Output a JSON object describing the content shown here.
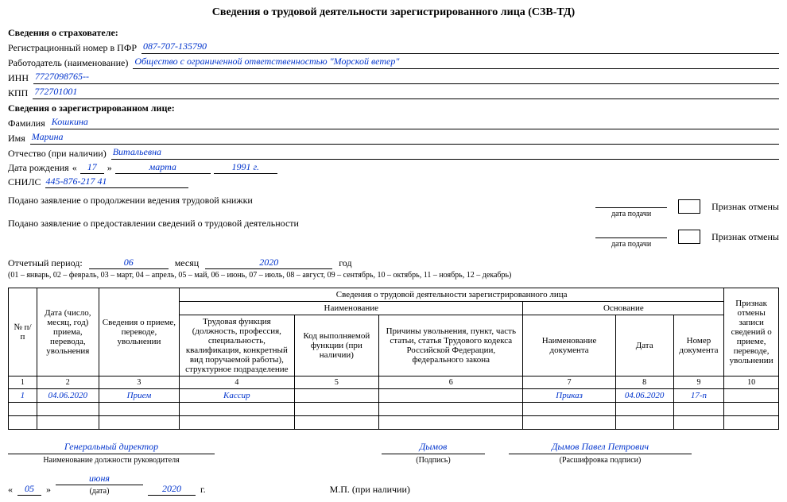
{
  "title": "Сведения о трудовой деятельности зарегистрированного лица (СЗВ-ТД)",
  "insurer": {
    "header": "Сведения о страхователе:",
    "reg_label": "Регистрационный номер в ПФР",
    "reg_value": "087-707-135790",
    "employer_label": "Работодатель (наименование)",
    "employer_value": "Общество с ограниченной ответственностью \"Морской ветер\"",
    "inn_label": "ИНН",
    "inn_value": "7727098765--",
    "kpp_label": "КПП",
    "kpp_value": "772701001"
  },
  "person": {
    "header": "Сведения о зарегистрированном лице:",
    "lastname_label": "Фамилия",
    "lastname_value": "Кошкина",
    "firstname_label": "Имя",
    "firstname_value": "Марина",
    "patronymic_label": "Отчество (при наличии)",
    "patronymic_value": "Витальевна",
    "dob_label": "Дата рождения",
    "dob_day": "17",
    "dob_month": "марта",
    "dob_year": "1991 г.",
    "snils_label": "СНИЛС",
    "snils_value": "445-876-217 41"
  },
  "apps": {
    "line1": "Подано заявление о продолжении ведения трудовой книжки",
    "line2": "Подано заявление о предоставлении сведений о трудовой деятельности",
    "date_submit": "дата подачи",
    "cancel_mark": "Признак отмены"
  },
  "period": {
    "label": "Отчетный период:",
    "month_value": "06",
    "month_label": "месяц",
    "year_value": "2020",
    "year_label": "год",
    "note": "(01 – январь, 02 – февраль, 03 – март, 04 – апрель, 05 – май, 06 – июнь, 07 – июль, 08 – август, 09 – сентябрь, 10 – октябрь, 11 – ноябрь, 12 – декабрь)"
  },
  "table": {
    "main_header": "Сведения о трудовой деятельности зарегистрированного лица",
    "col_np": "№ п/п",
    "col_date": "Дата (число, месяц, год) приема, перевода, увольнения",
    "col_info": "Сведения о приеме, переводе, увольнении",
    "naimen_header": "Наименование",
    "col_func": "Трудовая функция (должность, профессия, специальность, квалификация, конкретный вид поручаемой работы), структурное подразделение",
    "col_code": "Код выполняемой функции (при наличии)",
    "col_reason": "Причины увольнения, пункт, часть статьи, статья Трудового кодекса Российской Федерации, федерального закона",
    "osnov_header": "Основание",
    "col_docname": "Наименование документа",
    "col_docdate": "Дата",
    "col_docnum": "Номер документа",
    "col_cancel": "Признак отмены записи сведений о приеме, переводе, увольнении",
    "nums": [
      "1",
      "2",
      "3",
      "4",
      "5",
      "6",
      "7",
      "8",
      "9",
      "10"
    ],
    "row1": {
      "np": "1",
      "date": "04.06.2020",
      "info": "Прием",
      "func": "Кассир",
      "code": "",
      "reason": "",
      "docname": "Приказ",
      "docdate": "04.06.2020",
      "docnum": "17-п",
      "cancel": ""
    }
  },
  "sign": {
    "position": "Генеральный директор",
    "position_label": "Наименование должности руководителя",
    "signature": "Дымов",
    "signature_label": "(Подпись)",
    "fullname": "Дымов Павел Петрович",
    "fullname_label": "(Расшифровка подписи)",
    "day": "05",
    "month": "июня",
    "year": "2020",
    "year_suffix": "г.",
    "date_label": "(дата)",
    "stamp": "М.П. (при наличии)"
  }
}
